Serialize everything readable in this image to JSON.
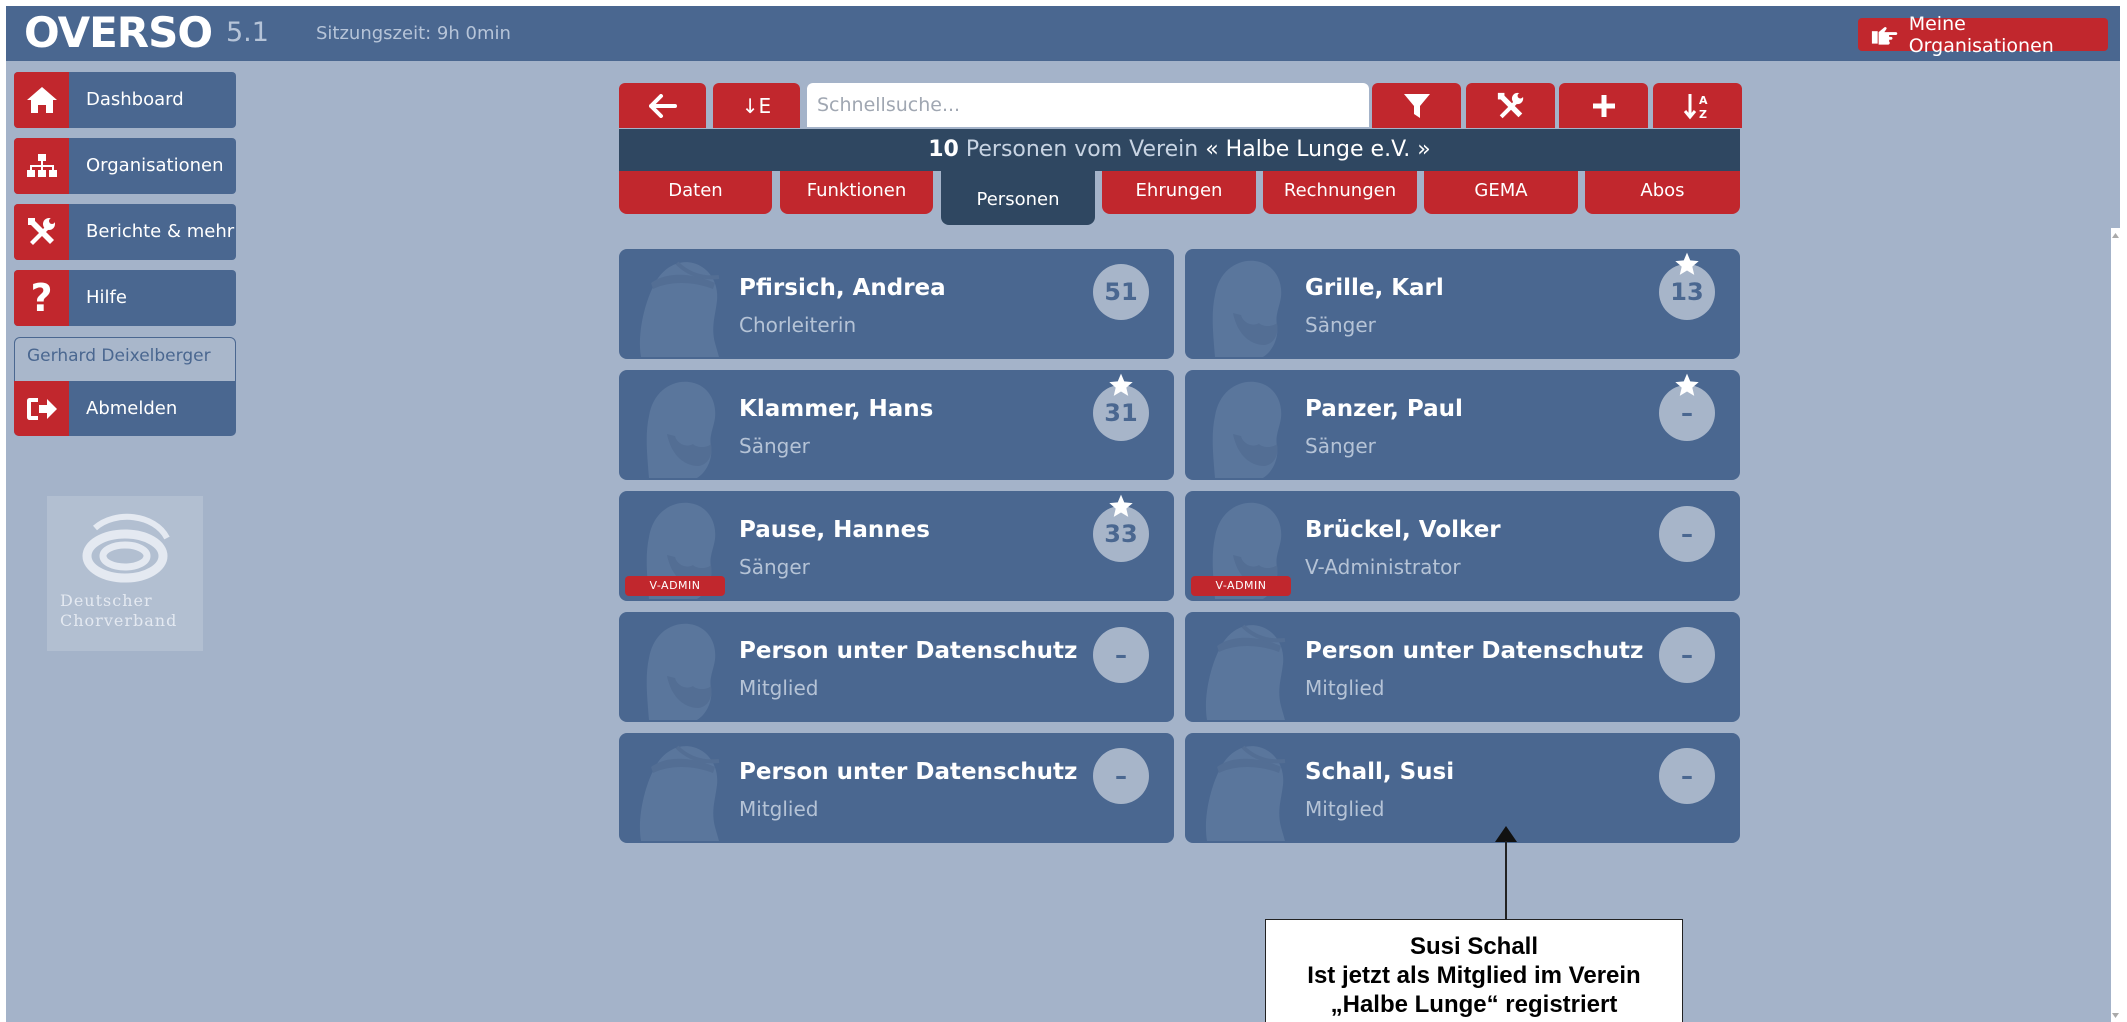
{
  "header": {
    "logo": "OVERSO",
    "version": "5.1",
    "session": "Sitzungszeit: 9h 0min",
    "my_orgs_button": "Meine Organisationen"
  },
  "sidebar": {
    "items": [
      {
        "label": "Dashboard",
        "icon": "home-icon"
      },
      {
        "label": "Organisationen",
        "icon": "org-chart-icon"
      },
      {
        "label": "Berichte & mehr",
        "icon": "tools-icon"
      },
      {
        "label": "Hilfe",
        "icon": "question-icon"
      }
    ],
    "user_name": "Gerhard Deixelberger",
    "logout_label": "Abmelden",
    "partner_logo": {
      "line1": "Deutscher",
      "line2": "Chorverband"
    }
  },
  "toolbar": {
    "back_icon": "arrow-left-icon",
    "sort_label": "↓E",
    "search_placeholder": "Schnellsuche...",
    "filter_icon": "filter-icon",
    "tools_icon": "tools-icon",
    "add_icon": "plus-icon",
    "sort_az_icon": "sort-alpha-icon"
  },
  "heading": {
    "count": "10",
    "text": "Personen vom Verein",
    "org_quoted": "« Halbe Lunge e.V. »"
  },
  "tabs": [
    {
      "label": "Daten",
      "active": false
    },
    {
      "label": "Funktionen",
      "active": false
    },
    {
      "label": "Personen",
      "active": true
    },
    {
      "label": "Ehrungen",
      "active": false
    },
    {
      "label": "Rechnungen",
      "active": false
    },
    {
      "label": "GEMA",
      "active": false
    },
    {
      "label": "Abos",
      "active": false
    }
  ],
  "persons": [
    {
      "name": "Pfirsich, Andrea",
      "role": "Chorleiterin",
      "badge": "51",
      "star": false,
      "vadmin": false,
      "gender": "female"
    },
    {
      "name": "Grille, Karl",
      "role": "Sänger",
      "badge": "13",
      "star": true,
      "vadmin": false,
      "gender": "male"
    },
    {
      "name": "Klammer, Hans",
      "role": "Sänger",
      "badge": "31",
      "star": true,
      "vadmin": false,
      "gender": "male"
    },
    {
      "name": "Panzer, Paul",
      "role": "Sänger",
      "badge": "–",
      "star": true,
      "vadmin": false,
      "gender": "male"
    },
    {
      "name": "Pause, Hannes",
      "role": "Sänger",
      "badge": "33",
      "star": true,
      "vadmin": true,
      "gender": "male"
    },
    {
      "name": "Brückel, Volker",
      "role": "V-Administrator",
      "badge": "–",
      "star": false,
      "vadmin": true,
      "gender": "male"
    },
    {
      "name": "Person unter Datenschutz",
      "role": "Mitglied",
      "badge": "–",
      "star": false,
      "vadmin": false,
      "gender": "male"
    },
    {
      "name": "Person unter Datenschutz",
      "role": "Mitglied",
      "badge": "–",
      "star": false,
      "vadmin": false,
      "gender": "female"
    },
    {
      "name": "Person unter Datenschutz",
      "role": "Mitglied",
      "badge": "–",
      "star": false,
      "vadmin": false,
      "gender": "female"
    },
    {
      "name": "Schall, Susi",
      "role": "Mitglied",
      "badge": "–",
      "star": false,
      "vadmin": false,
      "gender": "female"
    }
  ],
  "vadmin_label": "V-ADMIN",
  "callout": {
    "line1": "Susi Schall",
    "line2": "Ist jetzt als Mitglied im Verein",
    "line3": "„Halbe Lunge“ registriert"
  }
}
